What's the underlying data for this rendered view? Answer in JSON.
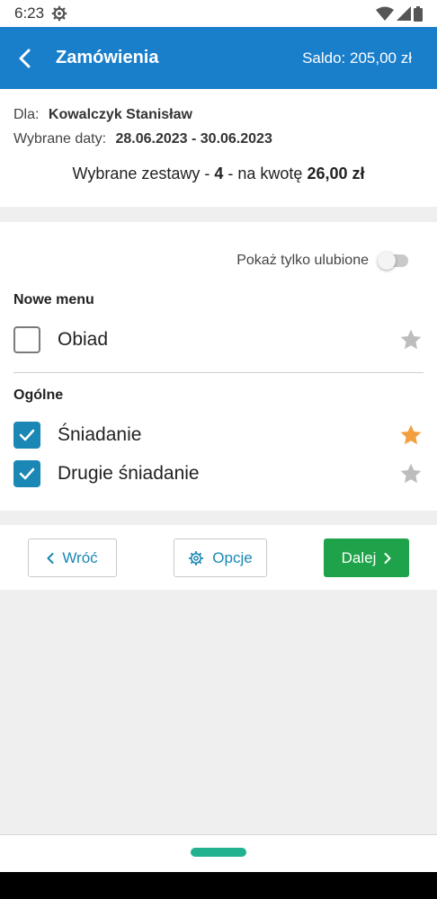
{
  "status_bar": {
    "time": "6:23",
    "icons": [
      "settings-gear-icon",
      "wifi-icon",
      "cell-signal-icon",
      "battery-icon"
    ]
  },
  "app_bar": {
    "title": "Zamówienia",
    "balance": "Saldo: 205,00 zł",
    "color": "#1a7fcb"
  },
  "summary": {
    "for_label": "Dla:",
    "for_value": "Kowalczyk Stanisław",
    "dates_label": "Wybrane daty:",
    "dates_value": "28.06.2023 - 30.06.2023",
    "sets_prefix": "Wybrane zestawy - ",
    "sets_count": "4",
    "sets_middle": " - na kwotę ",
    "sets_amount": "26,00 zł"
  },
  "filter": {
    "favorites_only_label": "Pokaż tylko ulubione",
    "favorites_only_on": false
  },
  "groups": [
    {
      "title": "Nowe menu",
      "items": [
        {
          "label": "Obiad",
          "checked": false,
          "favorite": false
        }
      ]
    },
    {
      "title": "Ogólne",
      "items": [
        {
          "label": "Śniadanie",
          "checked": true,
          "favorite": true
        },
        {
          "label": "Drugie śniadanie",
          "checked": true,
          "favorite": false
        }
      ]
    }
  ],
  "actions": {
    "back_label": "Wróć",
    "options_label": "Opcje",
    "next_label": "Dalej"
  },
  "colors": {
    "accent": "#1b87b4",
    "primary_button": "#1fa34a",
    "favorite_star": "#f2a03d",
    "inactive_star": "#bdbdbd",
    "nav_pill": "#22b290"
  }
}
